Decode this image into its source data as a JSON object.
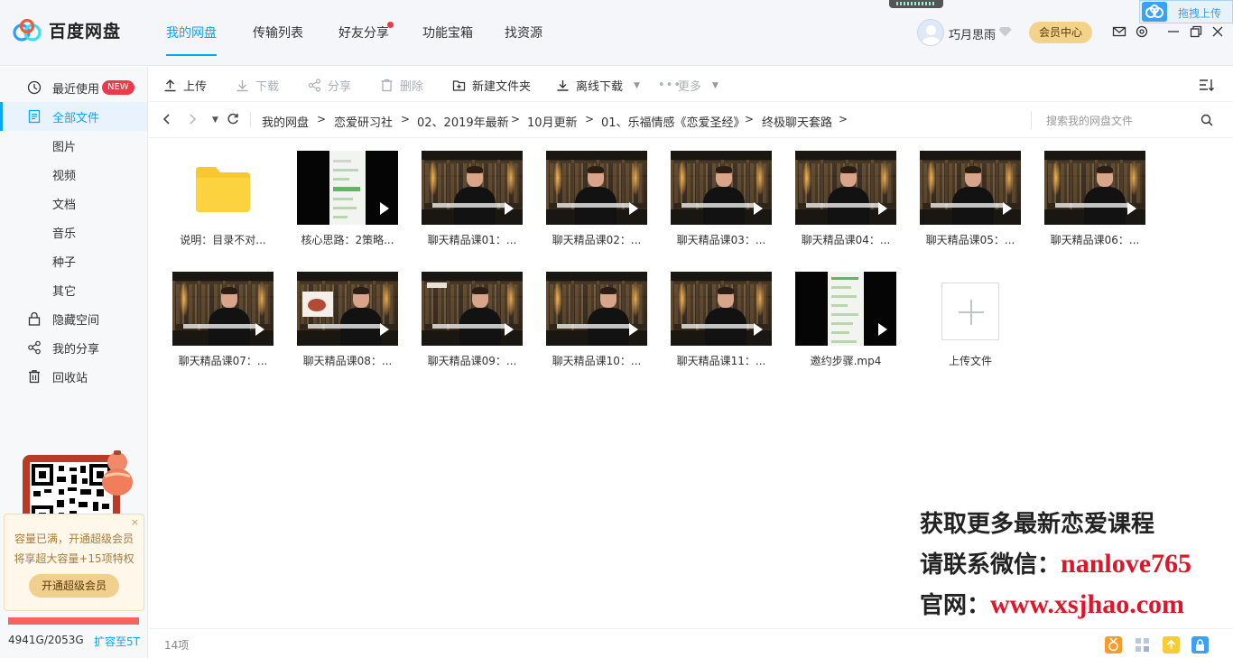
{
  "app": {
    "name": "百度网盘"
  },
  "nav": {
    "tabs": [
      {
        "label": "我的网盘",
        "active": true
      },
      {
        "label": "传输列表"
      },
      {
        "label": "好友分享",
        "dot": true
      },
      {
        "label": "功能宝箱"
      },
      {
        "label": "找资源"
      }
    ]
  },
  "user": {
    "name": "巧月思雨",
    "vip_button": "会员中心"
  },
  "drag_upload": {
    "label": "拖拽上传"
  },
  "sidebar": {
    "items": [
      {
        "label": "最近使用",
        "badge": "NEW",
        "icon": "clock-icon"
      },
      {
        "label": "全部文件",
        "icon": "file-list-icon",
        "active": true
      },
      {
        "label": "图片"
      },
      {
        "label": "视频"
      },
      {
        "label": "文档"
      },
      {
        "label": "音乐"
      },
      {
        "label": "种子"
      },
      {
        "label": "其它"
      },
      {
        "label": "隐藏空间",
        "icon": "lock-icon"
      },
      {
        "label": "我的分享",
        "icon": "share-icon"
      },
      {
        "label": "回收站",
        "icon": "trash-icon"
      }
    ],
    "upsell": {
      "line1": "容量已满，开通超级会员",
      "line2": "将享超大容量+15项特权",
      "button": "开通超级会员",
      "close": "×"
    },
    "quota": {
      "used": "4941G/2053G",
      "fill_fraction": 1.0,
      "expand": "扩容至5T"
    }
  },
  "toolbar": {
    "upload": "上传",
    "download": "下载",
    "share": "分享",
    "delete": "删除",
    "new_folder": "新建文件夹",
    "offline_download": "离线下载",
    "more": "更多"
  },
  "breadcrumb": {
    "items": [
      "我的网盘",
      "恋爱研习社",
      "02、2019年最新",
      "10月更新",
      "01、乐福情感《恋爱圣经》",
      "终极聊天套路"
    ],
    "separator": ">"
  },
  "search": {
    "placeholder": "搜索我的网盘文件"
  },
  "files": [
    {
      "name": "说明：目录不对...",
      "type": "folder"
    },
    {
      "name": "核心思路：2策略...",
      "type": "video-chat"
    },
    {
      "name": "聊天精品课01：...",
      "type": "video"
    },
    {
      "name": "聊天精品课02：...",
      "type": "video"
    },
    {
      "name": "聊天精品课03：...",
      "type": "video"
    },
    {
      "name": "聊天精品课04：...",
      "type": "video"
    },
    {
      "name": "聊天精品课05：...",
      "type": "video"
    },
    {
      "name": "聊天精品课06：...",
      "type": "video"
    },
    {
      "name": "聊天精品课07：...",
      "type": "video"
    },
    {
      "name": "聊天精品课08：...",
      "type": "video"
    },
    {
      "name": "聊天精品课09：...",
      "type": "video"
    },
    {
      "name": "聊天精品课10：...",
      "type": "video"
    },
    {
      "name": "聊天精品课11：...",
      "type": "video"
    },
    {
      "name": "邀约步骤.mp4",
      "type": "video-chat"
    },
    {
      "name": "上传文件",
      "type": "upload"
    }
  ],
  "watermark": {
    "line1": "获取更多最新恋爱课程",
    "line2_key": "请联系微信：",
    "line2_val": "nanlove765",
    "line3_key": "官网：",
    "line3_val": "www.xsjhao.com"
  },
  "status": {
    "count": "14项"
  },
  "colors": {
    "accent": "#06a7ff",
    "badge": "#f0384a",
    "vip": "#f3d38a",
    "watermark_red": "#e0152a"
  }
}
